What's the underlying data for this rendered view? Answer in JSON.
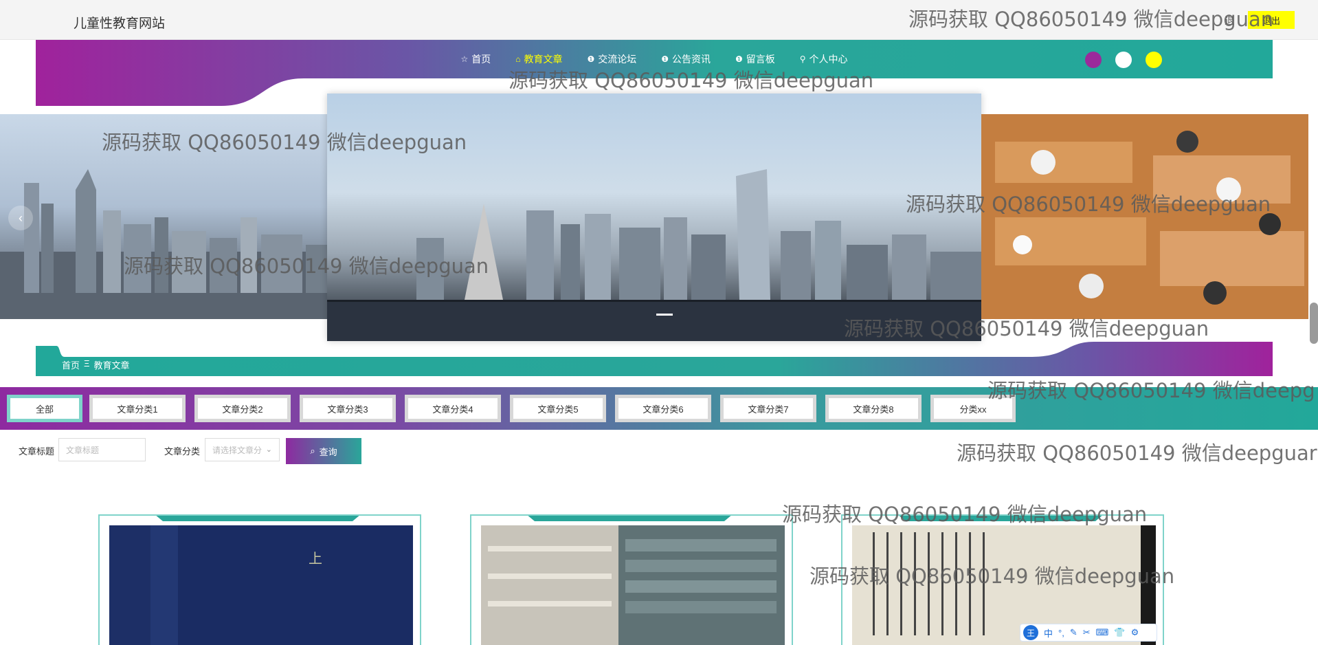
{
  "header": {
    "site_title": "儿童性教育网站",
    "user_text": "退",
    "logout_label": "退出"
  },
  "nav": {
    "items": [
      {
        "label": "首页",
        "icon": "star-icon",
        "glyph": "☆"
      },
      {
        "label": "教育文章",
        "icon": "bag-icon",
        "glyph": "⌂"
      },
      {
        "label": "交流论坛",
        "icon": "info-icon",
        "glyph": "❶"
      },
      {
        "label": "公告资讯",
        "icon": "info-icon",
        "glyph": "❶"
      },
      {
        "label": "留言板",
        "icon": "info-icon",
        "glyph": "❶"
      },
      {
        "label": "个人中心",
        "icon": "user-icon",
        "glyph": "⚲"
      }
    ],
    "active_index": 1,
    "theme_colors": [
      "#9b2a9b",
      "#ffffff",
      "#ffff00"
    ],
    "active_color": "#ffff00"
  },
  "carousel": {
    "prev_glyph": "‹",
    "slides": 3,
    "active_slide": 1
  },
  "breadcrumb": {
    "home": "首页",
    "separator": "Ξ",
    "current": "教育文章"
  },
  "categories": {
    "items": [
      "全部",
      "文章分类1",
      "文章分类2",
      "文章分类3",
      "文章分类4",
      "文章分类5",
      "文章分类6",
      "文章分类7",
      "文章分类8",
      "分类xx"
    ],
    "active_index": 0
  },
  "search": {
    "title_label": "文章标题",
    "title_placeholder": "文章标题",
    "category_label": "文章分类",
    "category_placeholder": "请选择文章分",
    "query_label": "查询"
  },
  "watermarks": [
    "源码获取 QQ86050149 微信deepguan",
    "源码获取 QQ86050149 微信deepguan",
    "源码获取 QQ86050149 微信deepguan",
    "源码获取 QQ86050149 微信deepguan",
    "源码获取 QQ86050149 微信deepguan",
    "源码获取 QQ86050149 微信deepguan",
    "源码获取 QQ86050149 微信deepg",
    "源码获取 QQ86050149 微信deepguar",
    "源码获取 QQ86050149 微信deepguan",
    "源码获取 QQ86050149 微信deepguan"
  ],
  "ime": {
    "logo": "王",
    "mode": "中"
  }
}
